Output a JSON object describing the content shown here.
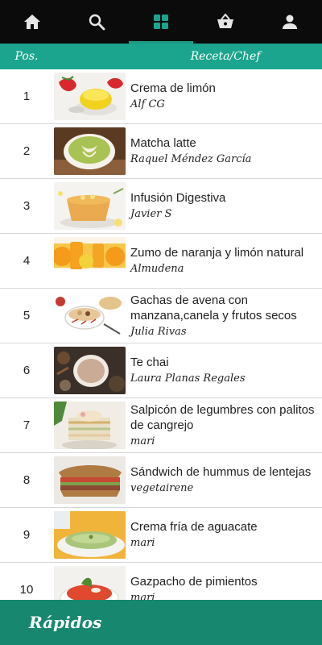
{
  "nav": {
    "items": [
      {
        "icon": "home-icon"
      },
      {
        "icon": "search-icon"
      },
      {
        "icon": "grid-icon",
        "active": true
      },
      {
        "icon": "basket-icon"
      },
      {
        "icon": "user-icon"
      }
    ]
  },
  "header": {
    "pos_label": "Pos.",
    "recipe_label": "Receta/Chef"
  },
  "recipes": [
    {
      "pos": "1",
      "title": "Crema de limón",
      "chef": "Alf CG"
    },
    {
      "pos": "2",
      "title": "Matcha latte",
      "chef": "Raquel Méndez García"
    },
    {
      "pos": "3",
      "title": "Infusión Digestiva",
      "chef": "Javier S"
    },
    {
      "pos": "4",
      "title": "Zumo de naranja y limón natural",
      "chef": "Almudena"
    },
    {
      "pos": "5",
      "title": "Gachas de avena con manzana,canela y frutos secos",
      "chef": "Julia Rivas"
    },
    {
      "pos": "6",
      "title": "Te chai",
      "chef": "Laura Planas Regales"
    },
    {
      "pos": "7",
      "title": "Salpicón de legumbres con palitos de cangrejo",
      "chef": "mari"
    },
    {
      "pos": "8",
      "title": "Sándwich de hummus de lentejas",
      "chef": "vegetairene"
    },
    {
      "pos": "9",
      "title": "Crema fría de aguacate",
      "chef": "mari"
    },
    {
      "pos": "10",
      "title": "Gazpacho de pimientos",
      "chef": "mari"
    }
  ],
  "bottom": {
    "label": "Rápidos"
  },
  "colors": {
    "nav_bg": "#0b0b0b",
    "accent": "#1ba58e",
    "bottom_bg": "#17876f"
  }
}
